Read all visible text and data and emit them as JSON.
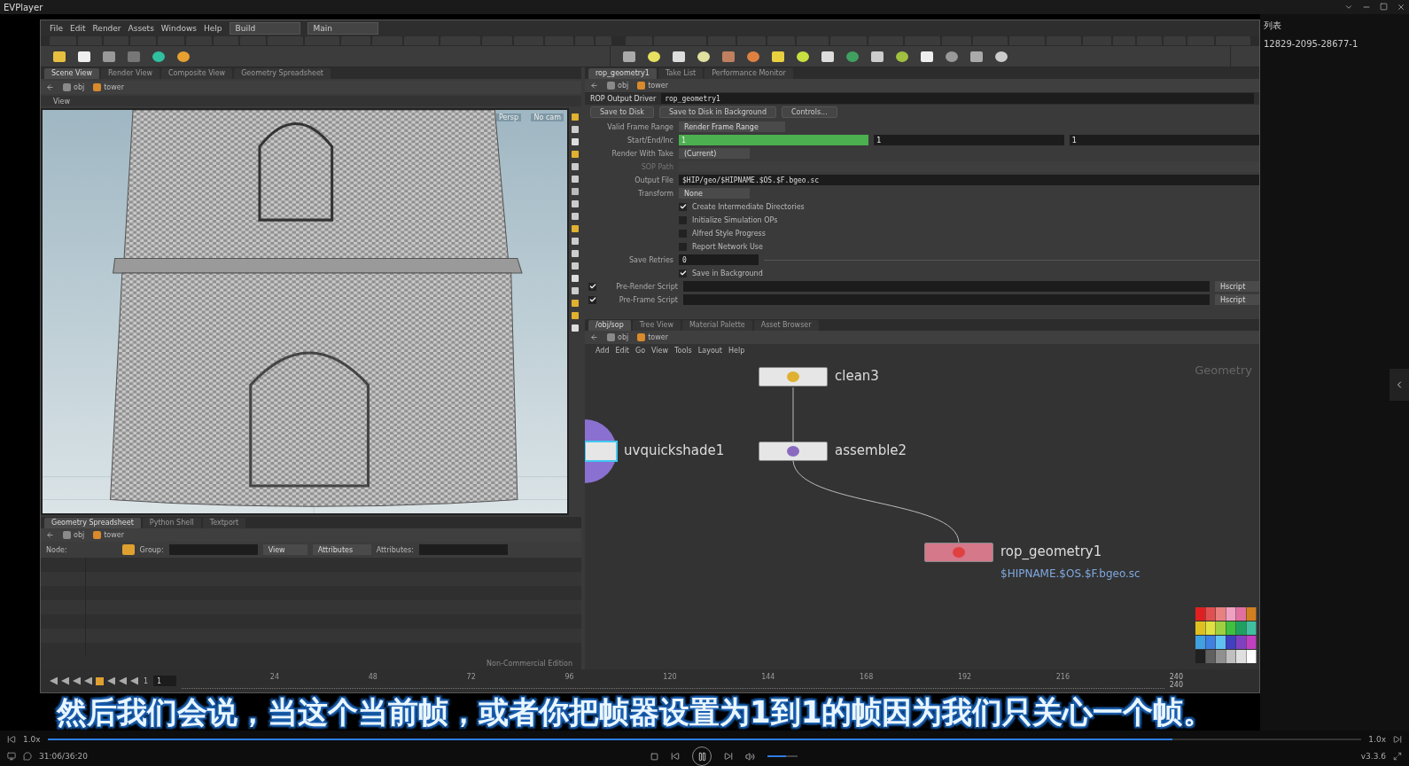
{
  "player": {
    "title": "EVPlayer",
    "sidebar_heading": "列表",
    "sidebar_item": "12829-2095-28677-1",
    "subtitle": "然后我们会说，当这个当前帧，或者你把帧器设置为1到1的帧因为我们只关心一个帧。",
    "speed_left": "1.0x",
    "speed_right": "1.0x",
    "time": "31:06/36:20",
    "version": "v3.3.6",
    "progress": {
      "level": 0.856
    },
    "volume": {
      "level": 0.6
    }
  },
  "houdini": {
    "menu": [
      "File",
      "Edit",
      "Render",
      "Assets",
      "Windows",
      "Help"
    ],
    "desktop": "Build",
    "context": "Main",
    "scene_pane": {
      "tabs": [
        {
          "label": "Scene View",
          "selected": true
        },
        {
          "label": "Render View",
          "selected": false
        },
        {
          "label": "Composite View",
          "selected": false
        },
        {
          "label": "Geometry Spreadsheet",
          "selected": false
        }
      ],
      "path": [
        "obj",
        "tower"
      ],
      "view_title": "View",
      "camera": "Persp",
      "cam_menu": "No cam"
    },
    "spreadsheet": {
      "tabs": [
        {
          "label": "Geometry Spreadsheet",
          "selected": true
        },
        {
          "label": "Python Shell",
          "selected": false
        },
        {
          "label": "Textport",
          "selected": false
        }
      ],
      "path": [
        "obj",
        "tower"
      ],
      "node_label": "Node:",
      "group_label": "Group:",
      "view_menu": "View",
      "attrib_menu": "Attributes",
      "attrib_label": "Attributes:",
      "edition": "Non-Commercial Edition"
    },
    "params": {
      "tabs": [
        {
          "label": "rop_geometry1",
          "selected": true
        },
        {
          "label": "Take List",
          "selected": false
        },
        {
          "label": "Performance Monitor",
          "selected": false
        }
      ],
      "path": [
        "obj",
        "tower"
      ],
      "op_type": "ROP Output Driver",
      "op_name": "rop_geometry1",
      "buttons": [
        "Save to Disk",
        "Save to Disk in Background",
        "Controls..."
      ],
      "rows": [
        {
          "kind": "menu",
          "label": "Valid Frame Range",
          "value": "Render Frame Range",
          "disabled": false
        },
        {
          "kind": "range",
          "label": "Start/End/Inc",
          "values": [
            {
              "text": "1",
              "highlighted": true
            },
            {
              "text": "1",
              "highlighted": false
            },
            {
              "text": "1",
              "highlighted": false
            }
          ]
        },
        {
          "kind": "menu",
          "label": "Render With Take",
          "value": "(Current)",
          "disabled": false
        },
        {
          "kind": "text",
          "label": "SOP Path",
          "disabled": true
        },
        {
          "kind": "text",
          "label": "Output File",
          "value": "$HIP/geo/$HIPNAME.$OS.$F.bgeo.sc",
          "disabled": false
        },
        {
          "kind": "menu",
          "label": "Transform",
          "value": "None",
          "disabled": false
        },
        {
          "kind": "check",
          "label": "Create Intermediate Directories",
          "checked": true
        },
        {
          "kind": "check",
          "label": "Initialize Simulation OPs",
          "checked": false
        },
        {
          "kind": "check",
          "label": "Alfred Style Progress",
          "checked": false
        },
        {
          "kind": "check",
          "label": "Report Network Use",
          "checked": false
        },
        {
          "kind": "number",
          "label": "Save Retries",
          "value": "0"
        },
        {
          "kind": "check",
          "label": "Save in Background",
          "checked": true
        },
        {
          "kind": "script",
          "label": "Pre-Render Script",
          "language": "Hscript",
          "enabled": true
        },
        {
          "kind": "script",
          "label": "Pre-Frame Script",
          "language": "Hscript",
          "enabled": true
        }
      ]
    },
    "network": {
      "tabs": [
        {
          "label": "/obj/sop",
          "selected": true
        },
        {
          "label": "Tree View",
          "selected": false
        },
        {
          "label": "Material Palette",
          "selected": false
        },
        {
          "label": "Asset Browser",
          "selected": false
        }
      ],
      "path": [
        "obj",
        "tower"
      ],
      "menu": [
        "Add",
        "Edit",
        "Go",
        "View",
        "Tools",
        "Layout",
        "Help"
      ],
      "context_label": "Geometry",
      "nodes": [
        {
          "name": "clean3",
          "kind": "sop",
          "color": "#e6e6e6"
        },
        {
          "name": "uvquickshade1",
          "kind": "partial",
          "color": "#e6e6e6"
        },
        {
          "name": "assemble2",
          "kind": "sop",
          "color": "#e6e6e6"
        },
        {
          "name": "rop_geometry1",
          "kind": "rop",
          "color": "#d4788a",
          "output": "$HIPNAME.$OS.$F.bgeo.sc"
        }
      ]
    },
    "timeline": {
      "start": "1",
      "current": "1",
      "ticks": [
        "24",
        "48",
        "72",
        "96",
        "120",
        "144",
        "168",
        "192",
        "216"
      ],
      "end": "240",
      "end_global": "240"
    }
  }
}
